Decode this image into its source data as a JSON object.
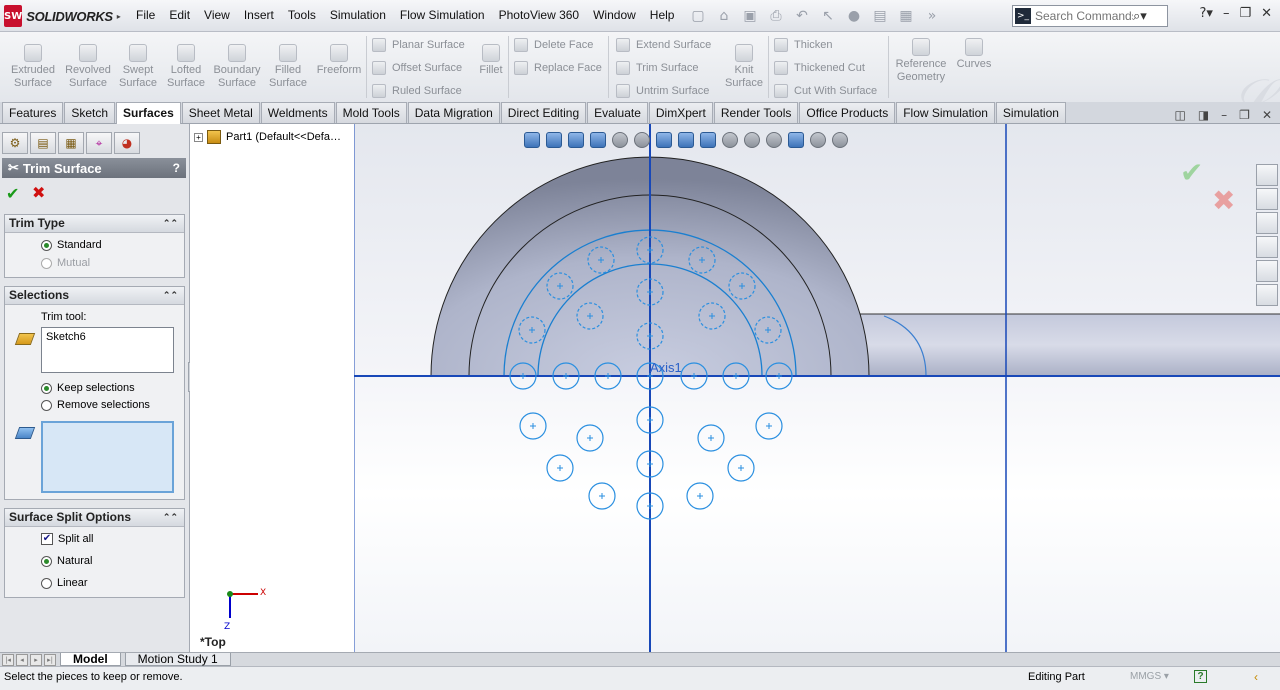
{
  "app": {
    "logo_mark": "SW",
    "logo_text": "SOLIDWORKS"
  },
  "menu": [
    "File",
    "Edit",
    "View",
    "Insert",
    "Tools",
    "Simulation",
    "Flow Simulation",
    "PhotoView 360",
    "Window",
    "Help"
  ],
  "search": {
    "placeholder": "Search Commands"
  },
  "ribbon": {
    "big": [
      {
        "label": "Extruded\nSurface"
      },
      {
        "label": "Revolved\nSurface"
      },
      {
        "label": "Swept\nSurface"
      },
      {
        "label": "Lofted\nSurface"
      },
      {
        "label": "Boundary\nSurface"
      },
      {
        "label": "Filled\nSurface"
      },
      {
        "label": "Freeform"
      }
    ],
    "small1": [
      "Planar Surface",
      "Offset Surface",
      "Ruled Surface"
    ],
    "fillet": "Fillet",
    "small2": [
      "Delete Face",
      "Replace Face"
    ],
    "small3": [
      "Extend Surface",
      "Trim Surface",
      "Untrim Surface"
    ],
    "knit": "Knit\nSurface",
    "small4": [
      "Thicken",
      "Thickened Cut",
      "Cut With Surface"
    ],
    "refgeo": "Reference\nGeometry",
    "curves": "Curves"
  },
  "tabs": [
    "Features",
    "Sketch",
    "Surfaces",
    "Sheet Metal",
    "Weldments",
    "Mold Tools",
    "Data Migration",
    "Direct Editing",
    "Evaluate",
    "DimXpert",
    "Render Tools",
    "Office Products",
    "Flow Simulation",
    "Simulation"
  ],
  "active_tab": "Surfaces",
  "property_manager": {
    "title": "Trim Surface",
    "help": "?",
    "trim_type": {
      "header": "Trim Type",
      "standard": "Standard",
      "mutual": "Mutual"
    },
    "selections": {
      "header": "Selections",
      "trim_tool_label": "Trim tool:",
      "trim_tool_value": "Sketch6",
      "keep": "Keep selections",
      "remove": "Remove selections"
    },
    "split_options": {
      "header": "Surface Split Options",
      "split_all": "Split all",
      "natural": "Natural",
      "linear": "Linear"
    }
  },
  "tree": {
    "root": "Part1  (Default<<Default>_..."
  },
  "graphics": {
    "axis_label": "Axis1",
    "view_name": "*Top",
    "triad_x": "X",
    "triad_z": "Z"
  },
  "bottom_tabs": [
    "Model",
    "Motion Study 1"
  ],
  "status": {
    "message": "Select the pieces to keep or remove.",
    "state": "Editing Part",
    "units": "MMGS",
    "units_arrow": "▾",
    "help": "?"
  }
}
